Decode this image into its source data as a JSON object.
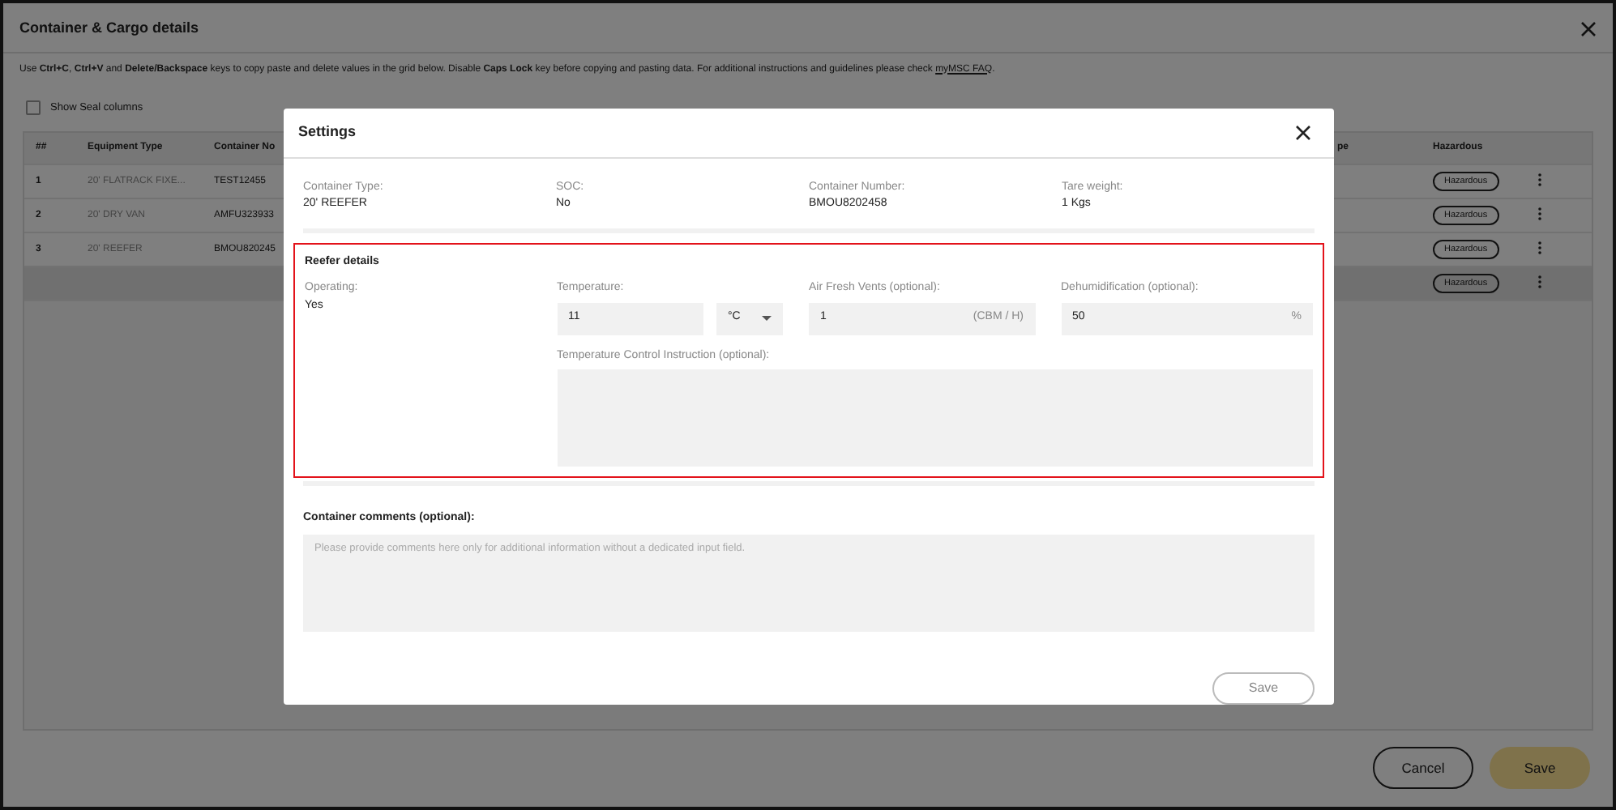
{
  "page": {
    "title": "Container & Cargo details",
    "instructions": {
      "text": "Use **Ctrl+C**, **Ctrl+V** and **Delete/Backspace** keys to copy paste and delete values in the grid below. Disable **Caps Lock** key before copying and pasting data. For additional instructions and guidelines please check",
      "link": "myMSC FAQ",
      "text_after": "."
    },
    "show_seal_columns": {
      "label": "Show Seal columns",
      "checked": false
    },
    "table": {
      "columns": [
        "##",
        "Equipment Type",
        "Container No",
        "pe",
        "Hazardous"
      ],
      "rows": [
        {
          "kind": "data",
          "number": "1",
          "equipment_type": "20' FLATRACK FIXE...",
          "container_number": "TEST12455",
          "hazardous": "Hazardous"
        },
        {
          "kind": "data",
          "number": "2",
          "equipment_type": "20' DRY VAN",
          "container_number": "AMFU323933",
          "hazardous": "Hazardous"
        },
        {
          "kind": "data",
          "number": "3",
          "equipment_type": "20' REEFER",
          "container_number": "BMOU820245",
          "hazardous": "Hazardous"
        },
        {
          "kind": "empty",
          "hazardous": "Hazardous"
        }
      ]
    },
    "buttons": [
      {
        "label": "Cancel",
        "kind": "outline"
      },
      {
        "label": "Save",
        "kind": "primary"
      }
    ]
  },
  "settings_dialog": {
    "title": "Settings",
    "info": [
      {
        "label": "Container Type:",
        "value": "20' REEFER"
      },
      {
        "label": "SOC:",
        "value": "No"
      },
      {
        "label": "Container Number:",
        "value": "BMOU8202458"
      },
      {
        "label": "Tare weight:",
        "value": "1 Kgs"
      }
    ],
    "reefer": {
      "title": "Reefer details",
      "highlighted": true,
      "operating": {
        "label": "Operating:",
        "value": "Yes"
      },
      "temperature": {
        "label": "Temperature:",
        "value": "11",
        "unit": "°C"
      },
      "air_fresh_vents": {
        "label": "Air Fresh Vents (optional):",
        "value": "1",
        "suffix": "(CBM / H)"
      },
      "dehumidification": {
        "label": "Dehumidification (optional):",
        "value": "50",
        "suffix": "%"
      },
      "instruction": {
        "label": "Temperature Control Instruction (optional):"
      }
    },
    "comments": {
      "label": "Container comments (optional):",
      "placeholder": "Please provide comments here only for additional information without a dedicated input field."
    },
    "save_button": {
      "label": "Save",
      "disabled": true
    }
  }
}
